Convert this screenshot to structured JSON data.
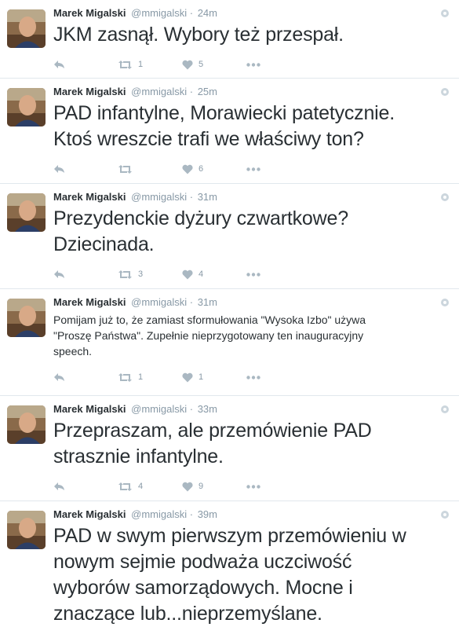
{
  "author": {
    "name": "Marek Migalski",
    "handle": "@mmigalski"
  },
  "colors": {
    "icon": "#aab8c2",
    "meta": "#8899a6",
    "text": "#292f33",
    "divider": "#e1e8ed"
  },
  "tweets": [
    {
      "time": "24m",
      "text_lines": [
        "JKM zasnął. Wybory też przespał."
      ],
      "retweets": "1",
      "likes": "5"
    },
    {
      "time": "25m",
      "text_lines": [
        "PAD infantylne, Morawiecki patetycznie.",
        "Ktoś wreszcie trafi we właściwy ton?"
      ],
      "retweets": "",
      "likes": "6"
    },
    {
      "time": "31m",
      "text_lines": [
        "Prezydenckie dyżury czwartkowe?",
        "Dziecinada."
      ],
      "retweets": "3",
      "likes": "4"
    },
    {
      "time": "31m",
      "text_lines": [
        "Pomijam już to, że zamiast sformułowania \"Wysoka Izbo\" używa",
        "\"Proszę Państwa\". Zupełnie nieprzygotowany ten inauguracyjny",
        "speech."
      ],
      "retweets": "1",
      "likes": "1"
    },
    {
      "time": "33m",
      "text_lines": [
        "Przepraszam, ale przemówienie PAD",
        "strasznie infantylne."
      ],
      "retweets": "4",
      "likes": "9"
    },
    {
      "time": "39m",
      "text_lines": [
        "PAD w swym pierwszym przemówieniu w",
        "nowym sejmie podważa uczciwość",
        "wyborów samorządowych. Mocne i",
        "znaczące lub...nieprzemyślane."
      ],
      "retweets": "",
      "likes": ""
    }
  ]
}
